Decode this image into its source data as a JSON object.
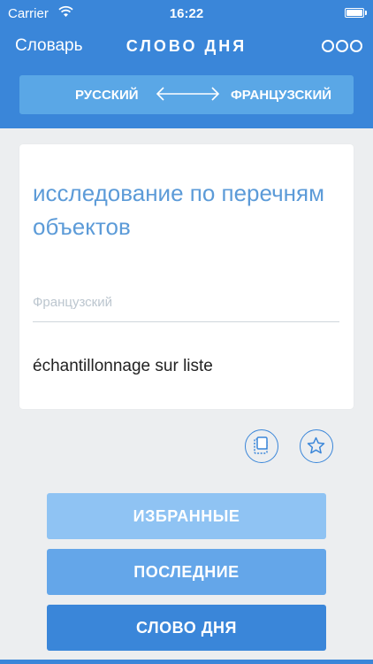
{
  "status_bar": {
    "carrier": "Carrier",
    "time": "16:22"
  },
  "nav": {
    "back_label": "Словарь",
    "title": "СЛОВО ДНЯ",
    "more_icon": "more-icon"
  },
  "language_bar": {
    "from": "РУССКИЙ",
    "to": "ФРАНЦУЗСКИЙ",
    "swap_icon": "swap-arrows-icon"
  },
  "card": {
    "source_word": "исследование по перечням объектов",
    "target_language_label": "Французский",
    "translation": "échantillonnage sur liste"
  },
  "actions": {
    "copy_icon": "copy-icon",
    "favorite_icon": "star-icon"
  },
  "menu": {
    "favorites": "ИЗБРАННЫЕ",
    "recent": "ПОСЛЕДНИЕ",
    "word_of_day": "СЛОВО ДНЯ"
  },
  "colors": {
    "primary": "#3a86d9",
    "light": "#8fc3f3",
    "mid": "#64a6e9",
    "word": "#5c9bd8"
  }
}
